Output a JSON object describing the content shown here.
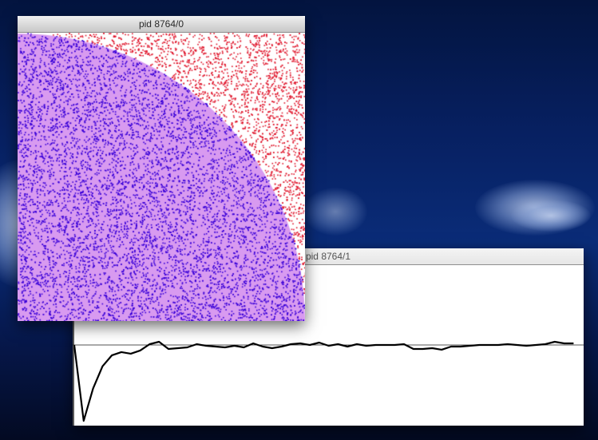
{
  "desktop": {
    "wallpaper_colors": [
      "#03143f",
      "#0a2c78",
      "#030a22"
    ]
  },
  "windows": {
    "scatter": {
      "title": "pid 8764/0",
      "colors": {
        "inside_fill": "#d89af0",
        "inside_points": "#3a00d8",
        "outside_points": "#e0142a",
        "background": "#ffffff"
      }
    },
    "convergence": {
      "title": "pid 8764/1"
    }
  },
  "chart_data": [
    {
      "type": "scatter",
      "title": "",
      "xlabel": "",
      "ylabel": "",
      "xlim": [
        0,
        1
      ],
      "ylim": [
        0,
        1
      ],
      "grid": false,
      "series": [
        {
          "color": "#3a00d8",
          "region": "inside quarter circle of radius 1 centered at bottom-left"
        },
        {
          "color": "#e0142a",
          "region": "outside quarter circle"
        }
      ]
    },
    {
      "type": "line",
      "title": "",
      "xlabel": "",
      "ylabel": "",
      "grid": false,
      "reference_line": 0,
      "ylim": [
        -1.0,
        1.0
      ],
      "x": [
        0,
        1,
        2,
        3,
        4,
        5,
        6,
        7,
        8,
        9,
        10,
        11,
        12,
        13,
        14,
        15,
        16,
        17,
        18,
        19,
        20,
        21,
        22,
        23,
        24,
        25,
        26,
        27,
        28,
        29,
        30,
        31,
        32,
        33,
        34,
        35,
        36,
        37,
        38,
        39,
        40,
        41,
        42,
        43,
        44,
        45,
        46,
        47,
        48,
        49,
        50,
        51,
        52,
        53
      ],
      "y": [
        0.0,
        -0.96,
        -0.55,
        -0.27,
        -0.13,
        -0.09,
        -0.11,
        -0.07,
        0.01,
        0.04,
        -0.05,
        -0.04,
        -0.03,
        0.01,
        -0.01,
        -0.02,
        -0.03,
        -0.01,
        -0.03,
        0.02,
        -0.02,
        -0.04,
        -0.02,
        0.01,
        0.02,
        0.0,
        0.03,
        -0.01,
        0.01,
        -0.02,
        0.01,
        -0.01,
        0.0,
        0.0,
        0.0,
        0.01,
        -0.05,
        -0.05,
        -0.04,
        -0.06,
        -0.02,
        -0.02,
        -0.01,
        0.0,
        0.0,
        0.0,
        0.01,
        0.0,
        -0.01,
        0.0,
        0.01,
        0.04,
        0.02,
        0.02
      ]
    }
  ]
}
